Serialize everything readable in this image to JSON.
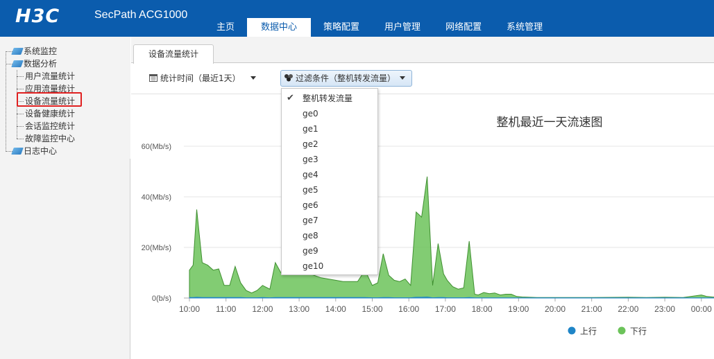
{
  "header": {
    "logo": "H3C",
    "product": "SecPath ACG1000",
    "nav": [
      "主页",
      "数据中心",
      "策略配置",
      "用户管理",
      "网络配置",
      "系统管理"
    ],
    "active_nav_index": 1,
    "bg_color": "#0b5cad"
  },
  "sidebar": {
    "nodes": [
      {
        "label": "系统监控",
        "icon": "folder-icon"
      },
      {
        "label": "数据分析",
        "icon": "folder-icon",
        "children": [
          "用户流量统计",
          "应用流量统计",
          "设备流量统计",
          "设备健康统计",
          "会话监控统计",
          "故障监控中心"
        ]
      },
      {
        "label": "日志中心",
        "icon": "folder-icon"
      }
    ],
    "selected": "设备流量统计"
  },
  "tab": {
    "label": "设备流量统计"
  },
  "toolbar": {
    "time_filter": "统计时间（最近1天）",
    "time_icon": "calendar-icon",
    "filter_label": "过滤条件（整机转发流量）",
    "filter_icon": "filter-icon"
  },
  "dropdown": {
    "options": [
      "整机转发流量",
      "ge0",
      "ge1",
      "ge2",
      "ge3",
      "ge4",
      "ge5",
      "ge6",
      "ge7",
      "ge8",
      "ge9",
      "ge10"
    ],
    "selected_index": 0
  },
  "chart_data": {
    "type": "area",
    "title": "整机最近一天流速图",
    "y_ticks": [
      "0(b/s)",
      "20(Mb/s)",
      "40(Mb/s)",
      "60(Mb/s)"
    ],
    "ylim": [
      0,
      60
    ],
    "x_ticks": [
      "10:00",
      "11:00",
      "12:00",
      "13:00",
      "14:00",
      "15:00",
      "16:00",
      "17:00",
      "18:00",
      "19:00",
      "20:00",
      "21:00",
      "22:00",
      "23:00",
      "00:00"
    ],
    "x_hours": [
      10,
      10.1,
      10.2,
      10.35,
      10.5,
      10.65,
      10.8,
      10.95,
      11.1,
      11.25,
      11.4,
      11.55,
      11.7,
      11.85,
      12.0,
      12.2,
      12.35,
      12.5,
      12.65,
      12.85,
      13.0,
      13.2,
      13.4,
      13.6,
      13.8,
      14.0,
      14.2,
      14.4,
      14.6,
      14.8,
      15.0,
      15.15,
      15.3,
      15.45,
      15.6,
      15.75,
      15.9,
      16.05,
      16.2,
      16.35,
      16.5,
      16.65,
      16.8,
      16.95,
      17.05,
      17.2,
      17.35,
      17.5,
      17.65,
      17.8,
      17.9,
      18.05,
      18.2,
      18.35,
      18.5,
      18.65,
      18.8,
      18.95,
      19.1,
      19.3,
      19.5,
      19.7,
      20.0,
      21.0,
      22.0,
      22.5,
      23.0,
      23.5,
      24.0,
      24.15,
      24.3,
      24.5
    ],
    "series": [
      {
        "name": "下行",
        "color": "#6cc35a",
        "values": [
          11,
          13,
          35,
          14,
          13,
          11,
          11.5,
          5,
          5,
          12.5,
          6,
          3,
          2,
          3,
          5,
          3.5,
          14,
          10,
          11,
          10,
          11,
          10,
          9,
          8,
          7.5,
          7,
          6.5,
          6.5,
          6.5,
          11,
          5,
          6,
          17.5,
          9,
          7,
          6.5,
          7.5,
          5,
          34,
          32,
          48,
          5,
          21.5,
          9.5,
          7,
          4.5,
          3.5,
          4,
          22.5,
          1.5,
          1.2,
          2.2,
          1.7,
          2,
          1.2,
          1.5,
          1.5,
          0.6,
          0.4,
          0.3,
          0.2,
          0.2,
          0.2,
          0.2,
          0.3,
          0.2,
          0.3,
          0.2,
          1.2,
          0.6,
          0.4,
          0.3
        ]
      },
      {
        "name": "上行",
        "color": "#1f85c7",
        "values": [
          0.2,
          0.2,
          0.3,
          0.2,
          0.2,
          0.2,
          0.2,
          0.2,
          0.2,
          0.2,
          0.2,
          0.1,
          0.1,
          0.1,
          0.2,
          0.1,
          0.2,
          0.2,
          0.2,
          0.2,
          0.2,
          0.2,
          0.2,
          0.2,
          0.2,
          0.2,
          0.2,
          0.2,
          0.2,
          0.2,
          0.1,
          0.1,
          0.2,
          0.2,
          0.1,
          0.1,
          0.1,
          0.1,
          0.3,
          0.3,
          0.4,
          0.1,
          0.2,
          0.2,
          0.1,
          0.1,
          0.1,
          0.1,
          0.2,
          0.05,
          0.05,
          0.05,
          0.05,
          0.05,
          0.05,
          0.05,
          0.05,
          0.05,
          0.05,
          0.05,
          0.05,
          0.05,
          0.05,
          0.05,
          0.05,
          0.05,
          0.05,
          0.05,
          0.05,
          0.05,
          0.05,
          0.05
        ]
      }
    ],
    "legend": [
      {
        "label": "上行",
        "color": "#1f85c7"
      },
      {
        "label": "下行",
        "color": "#6cc35a"
      }
    ],
    "legend_position": "bottom-right",
    "grid": true
  }
}
